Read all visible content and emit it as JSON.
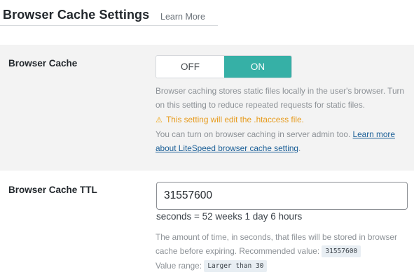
{
  "header": {
    "title": "Browser Cache Settings",
    "learn_more": "Learn More"
  },
  "browser_cache": {
    "label": "Browser Cache",
    "toggle": {
      "off_label": "OFF",
      "on_label": "ON",
      "selected": "ON"
    },
    "description": {
      "line1": "Browser caching stores static files locally in the user's browser. Turn on this setting to reduce repeated requests for static files.",
      "warning": "This setting will edit the .htaccess file.",
      "warning_icon": "warning-icon",
      "note": "You can turn on browser caching in server admin too.",
      "link_text": "Learn more about LiteSpeed browser cache setting",
      "note_end": "."
    }
  },
  "browser_cache_ttl": {
    "label": "Browser Cache TTL",
    "value": "31557600",
    "human_readable": "seconds = 52 weeks 1 day 6 hours",
    "description": "The amount of time, in seconds, that files will be stored in browser cache before expiring. Recommended value:",
    "recommended_value": "31557600",
    "range_label": "Value range:",
    "range_value": "Larger than 30"
  },
  "colors": {
    "accent": "#36b0a6",
    "link": "#1b5f97",
    "warning": "#e79a1a",
    "row_bg": "#f3f3f3"
  }
}
